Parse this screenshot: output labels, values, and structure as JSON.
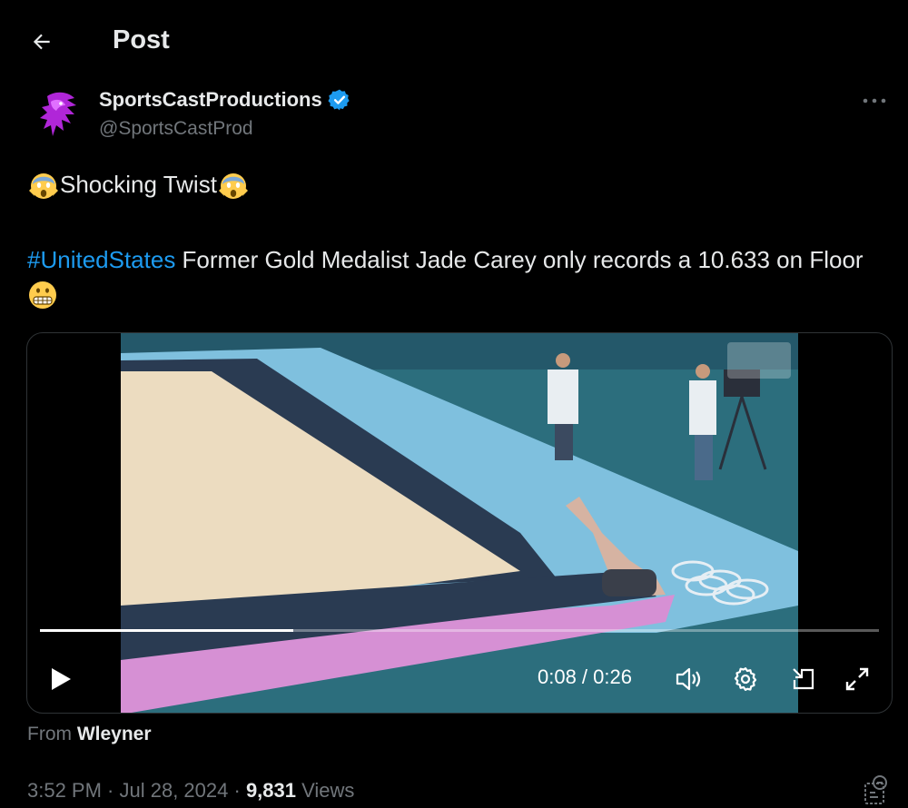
{
  "header": {
    "title": "Post"
  },
  "author": {
    "name": "SportsCastProductions",
    "handle": "@SportsCastProd",
    "verified": true,
    "avatar_icon": "purple-lion-logo"
  },
  "tweet": {
    "line1_text": "Shocking Twist",
    "hashtag": "#UnitedStates",
    "body_text": " Former Gold Medalist Jade Carey only records a 10.633 on Floor"
  },
  "video": {
    "current_time": "0:08",
    "duration": "0:26",
    "time_display": "0:08 / 0:26",
    "progress": 0.302,
    "controls": [
      "play-icon",
      "volume-icon",
      "settings-gear-icon",
      "picture-in-picture-icon",
      "fullscreen-icon"
    ]
  },
  "source": {
    "prefix": "From ",
    "name": "Wleyner"
  },
  "meta": {
    "time": "3:52 PM",
    "separator": " · ",
    "date": "Jul 28, 2024",
    "views_count": "9,831",
    "views_label": " Views"
  },
  "colors": {
    "background": "#000000",
    "text": "#e7e9ea",
    "muted": "#71767b",
    "link": "#1d9bf0",
    "verified": "#1d9bf0"
  }
}
